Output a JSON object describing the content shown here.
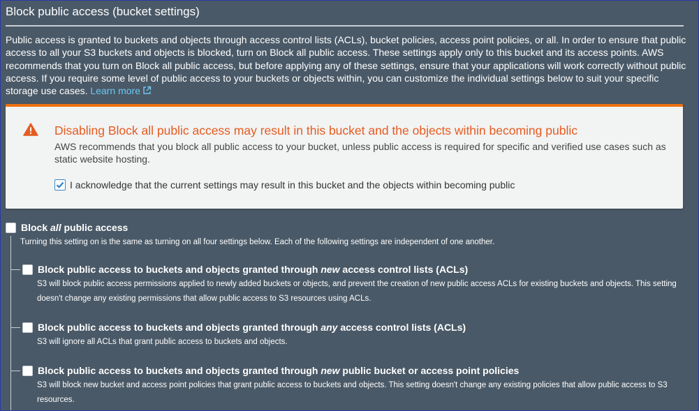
{
  "section": {
    "title": "Block public access (bucket settings)",
    "description": "Public access is granted to buckets and objects through access control lists (ACLs), bucket policies, access point policies, or all. In order to ensure that public access to all your S3 buckets and objects is blocked, turn on Block all public access. These settings apply only to this bucket and its access points. AWS recommends that you turn on Block all public access, but before applying any of these settings, ensure that your applications will work correctly without public access. If you require some level of public access to your buckets or objects within, you can customize the individual settings below to suit your specific storage use cases.",
    "learn_more": "Learn more"
  },
  "warning": {
    "title": "Disabling Block all public access may result in this bucket and the objects within becoming public",
    "body": "AWS recommends that you block all public access to your bucket, unless public access is required for specific and verified use cases such as static website hosting.",
    "acknowledge_label": "I acknowledge that the current settings may result in this bucket and the objects within becoming public",
    "acknowledge_checked": true
  },
  "block_all": {
    "label_prefix": "Block ",
    "label_emphasis": "all",
    "label_suffix": " public access",
    "description": "Turning this setting on is the same as turning on all four settings below. Each of the following settings are independent of one another.",
    "checked": false
  },
  "options": [
    {
      "label_prefix": "Block public access to buckets and objects granted through ",
      "label_emphasis": "new",
      "label_suffix": " access control lists (ACLs)",
      "description": "S3 will block public access permissions applied to newly added buckets or objects, and prevent the creation of new public access ACLs for existing buckets and objects. This setting doesn't change any existing permissions that allow public access to S3 resources using ACLs.",
      "checked": false
    },
    {
      "label_prefix": "Block public access to buckets and objects granted through ",
      "label_emphasis": "any",
      "label_suffix": " access control lists (ACLs)",
      "description": "S3 will ignore all ACLs that grant public access to buckets and objects.",
      "checked": false
    },
    {
      "label_prefix": "Block public access to buckets and objects granted through ",
      "label_emphasis": "new",
      "label_suffix": " public bucket or access point policies",
      "description": "S3 will block new bucket and access point policies that grant public access to buckets and objects. This setting doesn't change any existing policies that allow public access to S3 resources.",
      "checked": false
    }
  ],
  "icons": {
    "warning": "warning-triangle-icon",
    "external_link": "external-link-icon",
    "checkmark": "checkmark-icon"
  },
  "colors": {
    "background": "#4a5967",
    "link": "#6cc7f2",
    "warning_accent": "#ec7211",
    "warning_title": "#e55c21",
    "alert_background": "#f2f3f3",
    "checkbox_checked_border": "#3a88c8"
  }
}
